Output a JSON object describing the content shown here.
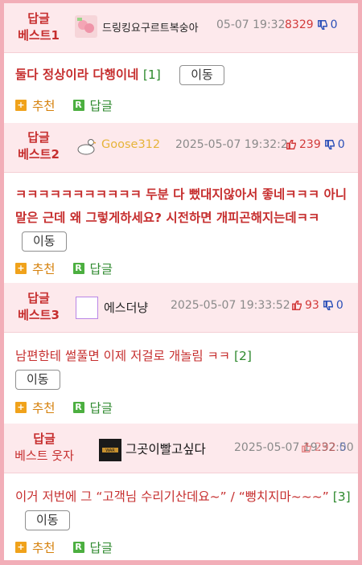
{
  "comments": [
    {
      "badge_top": "답글",
      "badge_bottom": "베스트1",
      "nickname": "드링킹요구르트복숭아",
      "nick_color": "#222222",
      "date": "05-07 19:32",
      "upvotes": "8329",
      "downvotes": "0",
      "text": "둘다 정상이라 다행이네",
      "reply_count": "[1]",
      "move_label": "이동",
      "recommend_label": "추천",
      "reply_label": "답글"
    },
    {
      "badge_top": "답글",
      "badge_bottom": "베스트2",
      "nickname": "Goose312",
      "nick_color": "#e6b43a",
      "date": "2025-05-07 19:32:2",
      "upvotes": "239",
      "downvotes": "0",
      "text": "ㅋㅋㅋㅋㅋㅋㅋㅋㅋㅋㅋ 두분 다 뻤대지않아서 좋네ㅋㅋㅋ 아니 말은 근데 왜 그렇게하세요? 시전하면 개피곤해지는데ㅋㅋ",
      "move_label": "이동",
      "recommend_label": "추천",
      "reply_label": "답글"
    },
    {
      "badge_top": "답글",
      "badge_bottom": "베스트3",
      "nickname": "에스더냥",
      "nick_color": "#222222",
      "date": "2025-05-07 19:33:52",
      "upvotes": "93",
      "downvotes": "0",
      "text": "남편한테 썰풀면 이제 저걸로 개놀림 ㅋㅋ",
      "reply_count": "[2]",
      "move_label": "이동",
      "recommend_label": "추천",
      "reply_label": "답글"
    },
    {
      "badge_top": "답글",
      "badge_bottom": "베스트 웃자",
      "nickname": "그곳이빨고싶다",
      "nick_color": "#111111",
      "date": "2025-05-07 19:32:50",
      "upvotes": "292",
      "downvotes": "0",
      "text": "이거 저번에 그 “고객님 수리기산데요~” / “뻥치지마~~~”",
      "reply_count": "[3]",
      "move_label": "이동",
      "recommend_label": "추천",
      "reply_label": "답글"
    }
  ]
}
